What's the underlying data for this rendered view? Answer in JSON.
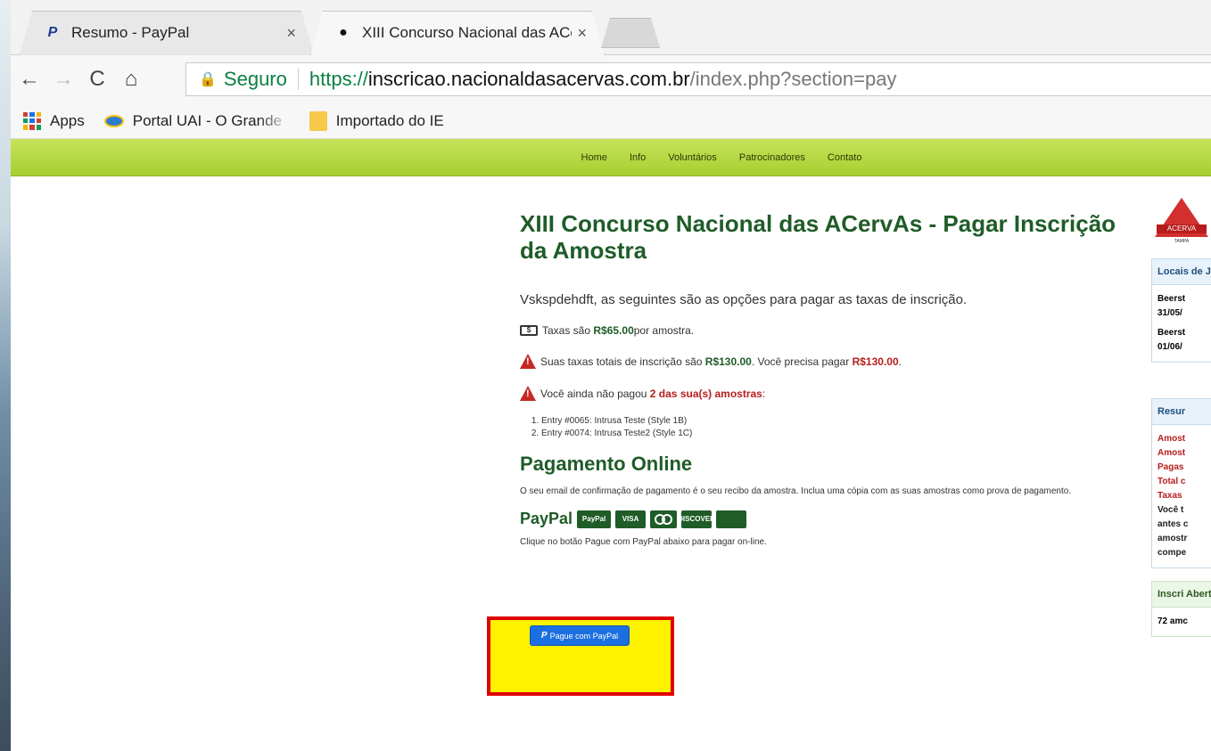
{
  "tabs": [
    {
      "favicon": "paypal-icon",
      "title": "Resumo - PayPal",
      "close": "×"
    },
    {
      "favicon": "beer-icon",
      "title": "XIII Concurso Nacional das ACervAs",
      "close": "×"
    }
  ],
  "toolbar": {
    "back": "←",
    "forward": "→",
    "reload": "C",
    "home": "⌂",
    "secure_label": "Seguro",
    "url_proto": "https://",
    "url_host": "inscricao.nacionaldasacervas.com.br",
    "url_path": "/index.php?section=pay"
  },
  "bookmarks": [
    {
      "icon": "apps-icon",
      "label": "Apps"
    },
    {
      "icon": "uai-icon",
      "label": "Portal UAI - O Grande"
    },
    {
      "icon": "folder-icon",
      "label": "Importado do IE"
    }
  ],
  "sitenav": [
    "Home",
    "Info",
    "Voluntários",
    "Patrocinadores",
    "Contato"
  ],
  "main": {
    "title": "XIII Concurso Nacional das ACervAs - Pagar Inscrição da Amostra",
    "intro": "Vskspdehdft, as seguintes são as opções para pagar as taxas de inscrição.",
    "fee_pre": "Taxas são ",
    "fee_value": "R$65.00",
    "fee_post": " por amostra.",
    "total_pre": "Suas taxas totais de inscrição são ",
    "total_value": "R$130.00",
    "total_mid": ". Você precisa pagar ",
    "total_due": "R$130.00",
    "total_post": ".",
    "unpaid_pre": "Você ainda não pagou ",
    "unpaid_value": "2 das sua(s) amostras",
    "unpaid_post": ":",
    "entries": [
      "Entry #0065: Intrusa Teste (Style 1B)",
      "Entry #0074: Intrusa Teste2 (Style 1C)"
    ],
    "online_heading": "Pagamento Online",
    "email_note": "O seu email de confirmação de pagamento é o seu recibo da amostra. Inclua uma cópia com as suas amostras como prova de pagamento.",
    "paypal_heading": "PayPal",
    "cards": [
      "PayPal",
      "VISA",
      "MasterCard",
      "DISCOVER",
      "AMERICAN EXPRESS"
    ],
    "click_note": "Clique no botão Pague com PayPal abaixo para pagar on-line.",
    "pay_button": "Pague com PayPal",
    "pay_button_icon": "P"
  },
  "sidebar": {
    "logo_band": "ACERVA",
    "logo_caption": "TAMPA",
    "panel1_title": "Locais de Ju",
    "panel1_rows": [
      "Beerst",
      "31/05/",
      "Beerst",
      "01/06/"
    ],
    "panel2_title": "Resur",
    "panel2_rows": [
      "Amost",
      "Amost",
      "Pagas",
      "Total c",
      "Taxas",
      "Você t",
      "antes c",
      "amostr",
      "compe"
    ],
    "panel3_title": "Inscri Abert",
    "panel3_rows": [
      "72 amc"
    ]
  },
  "colors": {
    "heading_green": "#1f5c28",
    "accent_red": "#b71c1c",
    "nav_green": "#a6cf31",
    "highlight_yellow": "#fff200",
    "highlight_border": "#e00000",
    "paypal_blue": "#1c6fe0"
  }
}
